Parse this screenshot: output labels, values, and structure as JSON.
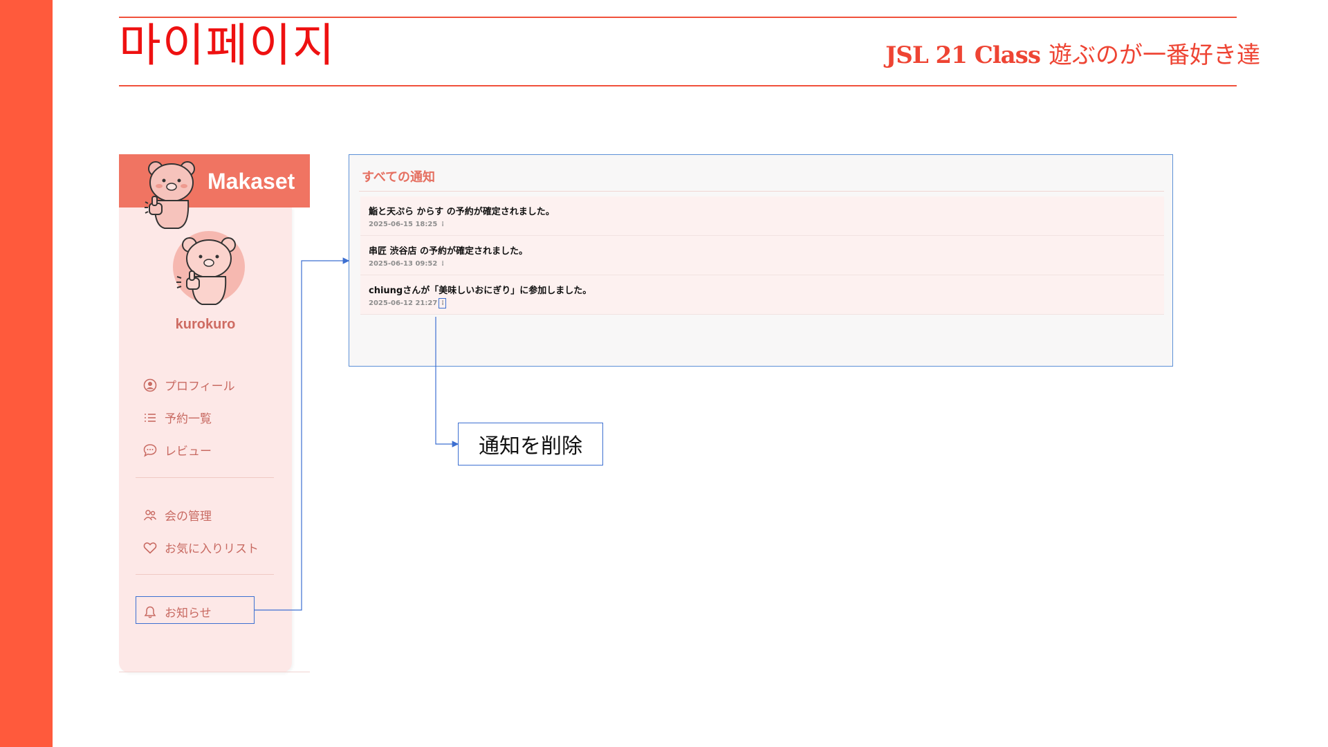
{
  "slide": {
    "title": "마이페이지",
    "class_name": "JSL 21 Class",
    "class_subtitle": "遊ぶのが一番好き達",
    "accent_color": "#ff5a3c"
  },
  "sidebar": {
    "brand": "Makaset",
    "mascot_icon": "bear-thumbs-up-icon",
    "username": "kurokuro",
    "menu": [
      {
        "label": "プロフィール",
        "icon": "user-circle-icon"
      },
      {
        "label": "予約一覧",
        "icon": "list-icon"
      },
      {
        "label": "レビュー",
        "icon": "chat-bubble-icon"
      },
      {
        "label": "会の管理",
        "icon": "group-icon"
      },
      {
        "label": "お気に入りリスト",
        "icon": "heart-icon"
      },
      {
        "label": "お知らせ",
        "icon": "bell-icon"
      }
    ],
    "accent_color": "#f07462"
  },
  "notifications": {
    "title": "すべての通知",
    "items": [
      {
        "message": "鮨と天ぷら からす の予約が確定されました。",
        "time": "2025-06-15 18:25",
        "menu_glyph": "⁞"
      },
      {
        "message": "串匠 渋谷店 の予約が確定されました。",
        "time": "2025-06-13 09:52",
        "menu_glyph": "⁞"
      },
      {
        "message": "chiungさんが「美味しいおにぎり」に参加しました。",
        "time": "2025-06-12 21:27",
        "menu_glyph": "⁞"
      }
    ]
  },
  "callout": {
    "label": "通知を削除",
    "border_color": "#3c6fd1"
  }
}
